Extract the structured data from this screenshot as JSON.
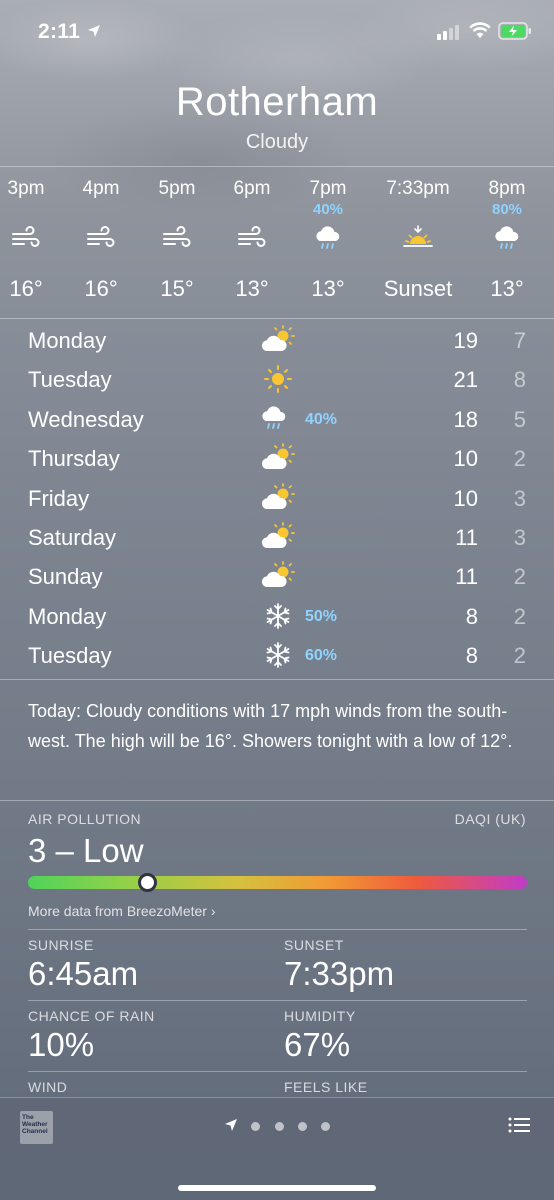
{
  "status_bar": {
    "time": "2:11"
  },
  "location": {
    "city": "Rotherham",
    "condition": "Cloudy"
  },
  "hourly": [
    {
      "time": "3pm",
      "icon": "wind-icon",
      "precip": "",
      "temp": "16°"
    },
    {
      "time": "4pm",
      "icon": "wind-icon",
      "precip": "",
      "temp": "16°"
    },
    {
      "time": "5pm",
      "icon": "wind-icon",
      "precip": "",
      "temp": "15°"
    },
    {
      "time": "6pm",
      "icon": "wind-icon",
      "precip": "",
      "temp": "13°"
    },
    {
      "time": "7pm",
      "icon": "rain-cloud-icon",
      "precip": "40%",
      "temp": "13°"
    },
    {
      "time": "7:33pm",
      "icon": "sunset-icon",
      "precip": "",
      "temp": "Sunset"
    },
    {
      "time": "8pm",
      "icon": "rain-cloud-icon",
      "precip": "80%",
      "temp": "13°"
    }
  ],
  "daily": [
    {
      "day": "Monday",
      "icon": "partly-cloudy-icon",
      "precip": "",
      "high": "19",
      "low": "7"
    },
    {
      "day": "Tuesday",
      "icon": "sun-icon",
      "precip": "",
      "high": "21",
      "low": "8"
    },
    {
      "day": "Wednesday",
      "icon": "rain-cloud-icon",
      "precip": "40%",
      "high": "18",
      "low": "5"
    },
    {
      "day": "Thursday",
      "icon": "partly-cloudy-icon",
      "precip": "",
      "high": "10",
      "low": "2"
    },
    {
      "day": "Friday",
      "icon": "partly-cloudy-icon",
      "precip": "",
      "high": "10",
      "low": "3"
    },
    {
      "day": "Saturday",
      "icon": "partly-cloudy-icon",
      "precip": "",
      "high": "11",
      "low": "3"
    },
    {
      "day": "Sunday",
      "icon": "partly-cloudy-icon",
      "precip": "",
      "high": "11",
      "low": "2"
    },
    {
      "day": "Monday",
      "icon": "snowflake-icon",
      "precip": "50%",
      "high": "8",
      "low": "2"
    },
    {
      "day": "Tuesday",
      "icon": "snowflake-icon",
      "precip": "60%",
      "high": "8",
      "low": "2"
    }
  ],
  "summary": "Today: Cloudy conditions with 17 mph winds from the south-west. The high will be 16°. Showers tonight with a low of 12°.",
  "air_pollution": {
    "title": "AIR POLLUTION",
    "source": "DAQI (UK)",
    "value": "3 – Low",
    "level_fraction": 0.24,
    "more_link": "More data from BreezoMeter",
    "bar_colors": [
      "#4fd35a",
      "#d5c13e",
      "#f19a34",
      "#ef5a3d",
      "#c03cc8"
    ]
  },
  "details": {
    "sunrise": {
      "label": "SUNRISE",
      "value": "6:45am"
    },
    "sunset": {
      "label": "SUNSET",
      "value": "7:33pm"
    },
    "chance_of_rain": {
      "label": "CHANCE OF RAIN",
      "value": "10%"
    },
    "humidity": {
      "label": "HUMIDITY",
      "value": "67%"
    },
    "wind": {
      "label": "WIND"
    },
    "feels_like": {
      "label": "FEELS LIKE"
    }
  },
  "bottom_bar": {
    "logo_text": "The Weather Channel",
    "page_count": 4,
    "active_page": "current-location"
  },
  "colors": {
    "precip_accent": "#8fd3ff"
  }
}
